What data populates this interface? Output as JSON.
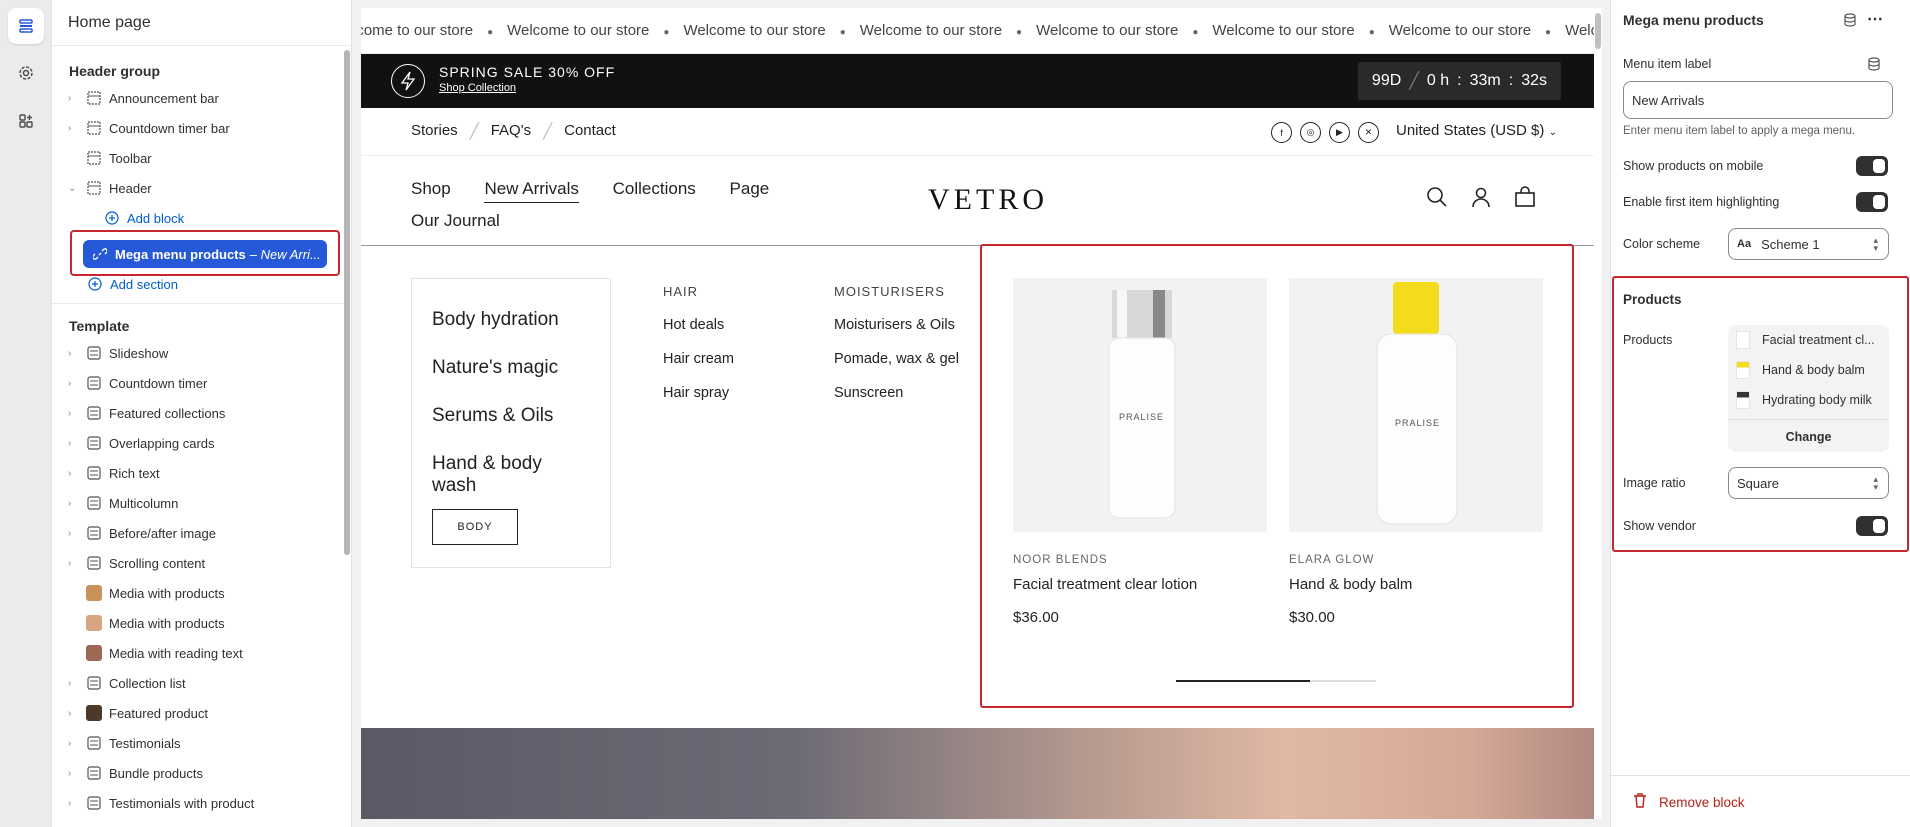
{
  "left_panel": {
    "title": "Home page",
    "header_group_label": "Header group",
    "header_items": [
      "Announcement bar",
      "Countdown timer bar",
      "Toolbar",
      "Header"
    ],
    "add_block": "Add block",
    "selected_block": {
      "name": "Mega menu products",
      "suffix": "– New Arri..."
    },
    "add_section": "Add section",
    "template_label": "Template",
    "template_items": [
      "Slideshow",
      "Countdown timer",
      "Featured collections",
      "Overlapping cards",
      "Rich text",
      "Multicolumn",
      "Before/after image",
      "Scrolling content",
      "Media with products",
      "Media with products",
      "Media with reading text",
      "Collection list",
      "Featured product",
      "Testimonials",
      "Bundle products",
      "Testimonials with product"
    ]
  },
  "preview": {
    "announcement": [
      "lcome to our store",
      "Welcome to our store",
      "Welcome to our store",
      "Welcome to our store",
      "Welcome to our store",
      "Welcome to our store",
      "Welcome to our store",
      "Welcom"
    ],
    "countdown": {
      "title": "SPRING SALE 30% OFF",
      "link": "Shop Collection",
      "days": "99D",
      "hours": "0 h",
      "minutes": "33m",
      "seconds": "32s",
      "sep": ":"
    },
    "toolbar": {
      "links": [
        "Stories",
        "FAQ's",
        "Contact"
      ],
      "currency": "United States (USD $)",
      "social": [
        "facebook-icon",
        "instagram-icon",
        "youtube-icon",
        "x-icon"
      ]
    },
    "nav": [
      "Shop",
      "New Arrivals",
      "Collections",
      "Page",
      "Our Journal"
    ],
    "logo": "VETRO",
    "mega": {
      "categories": [
        "Body hydration",
        "Nature's magic",
        "Serums & Oils",
        "Hand & body wash"
      ],
      "body_button": "BODY",
      "col1": {
        "heading": "HAIR",
        "links": [
          "Hot deals",
          "Hair cream",
          "Hair spray"
        ]
      },
      "col2": {
        "heading": "MOISTURISERS",
        "links": [
          "Moisturisers & Oils",
          "Pomade, wax & gel",
          "Sunscreen"
        ]
      },
      "products": [
        {
          "vendor": "NOOR BLENDS",
          "name": "Facial treatment clear lotion",
          "price": "$36.00",
          "brand_label": "PRALISE"
        },
        {
          "vendor": "ELARA GLOW",
          "name": "Hand & body balm",
          "price": "$30.00",
          "brand_label": "PRALISE"
        }
      ],
      "slider_progress": 0.67
    }
  },
  "right_panel": {
    "title": "Mega menu products",
    "menu_item_label": "Menu item label",
    "menu_item_value": "New Arrivals",
    "menu_item_help": "Enter menu item label to apply a mega menu.",
    "show_products_mobile": "Show products on mobile",
    "enable_first_highlight": "Enable first item highlighting",
    "color_scheme_label": "Color scheme",
    "color_scheme_value": "Scheme 1",
    "products_heading": "Products",
    "products_label": "Products",
    "product_items": [
      "Facial treatment cl...",
      "Hand & body balm",
      "Hydrating body milk"
    ],
    "change": "Change",
    "image_ratio_label": "Image ratio",
    "image_ratio_value": "Square",
    "show_vendor": "Show vendor",
    "remove_block": "Remove block"
  },
  "colors": {
    "accent": "#2659d8",
    "highlight_outline": "#c5262f",
    "danger": "#b42318"
  }
}
